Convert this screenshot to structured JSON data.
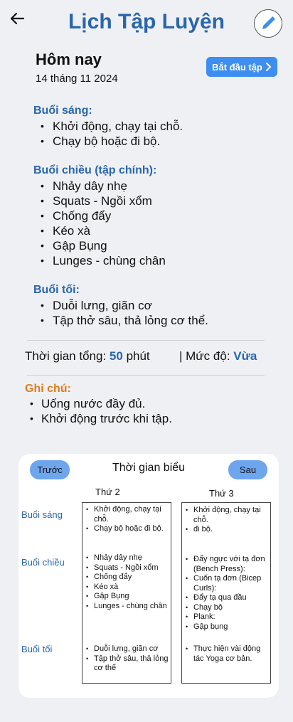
{
  "header": {
    "title": "Lịch Tập Luyện",
    "back_icon": "arrow-left-icon",
    "edit_icon": "pencil-icon"
  },
  "today": {
    "title": "Hôm nay",
    "date": "14 tháng 11 2024",
    "start_label": "Bắt đầu tập",
    "start_icon": "chevron-right-icon"
  },
  "morning": {
    "heading": "Buổi sáng:",
    "items": [
      "Khởi động, chạy tại chỗ.",
      "Chạy bộ hoặc đi bộ."
    ]
  },
  "afternoon": {
    "heading": "Buổi chiều (tập chính):",
    "items": [
      "Nhảy dây nhẹ",
      "Squats - Ngồi xổm",
      "Chống đẩy",
      "Kéo xà",
      "Gập Bụng",
      "Lunges - chùng chân"
    ]
  },
  "evening": {
    "heading": "Buổi tối:",
    "items": [
      "Duỗi lưng, giãn cơ",
      "Tập thở sâu, thả lỏng cơ thể."
    ]
  },
  "stats": {
    "total_label": "Thời gian tổng:",
    "total_value": "50",
    "total_unit": "phút",
    "level_label": "| Mức độ:",
    "level_value": "Vừa"
  },
  "notes": {
    "heading": "Ghi chú:",
    "items": [
      "Uống nước đầy đủ.",
      "Khởi động trước khi tập."
    ]
  },
  "timetable": {
    "title": "Thời gian biểu",
    "prev_label": "Trước",
    "next_label": "Sau",
    "row_labels": [
      "Buổi sáng",
      "Buổi chiều",
      "Buổi tối"
    ],
    "days": [
      {
        "name": "Thứ 2",
        "morning": [
          "Khởi động, chạy tại chỗ.",
          "Chạy bộ hoặc đi bộ."
        ],
        "afternoon": [
          "Nhảy dây nhẹ",
          "Squats - Ngồi xổm",
          "Chống đẩy",
          "Kéo xà",
          "Gập Bụng",
          "Lunges - chùng chân"
        ],
        "evening": [
          "Duỗi lưng, giãn cơ",
          "Tập thở sâu, thả lỏng cơ thể"
        ]
      },
      {
        "name": "Thứ 3",
        "morning": [
          "Khởi động, chạy tại chỗ.",
          "đi bộ."
        ],
        "afternoon": [
          "Đẩy ngực với tạ đơn (Bench Press):",
          "Cuốn tạ đơn (Bicep Curls):",
          "Đẩy tạ qua đầu",
          "Chạy bộ",
          "Plank:",
          "Gập bụng"
        ],
        "evening": [
          "Thực hiện vài động tác Yoga cơ bản."
        ]
      }
    ]
  },
  "colors": {
    "accent": "#2a66ad",
    "button": "#3d8ef0",
    "note": "#e07b1a",
    "nav_button": "#6ea6ee",
    "background": "#eef0f3"
  }
}
